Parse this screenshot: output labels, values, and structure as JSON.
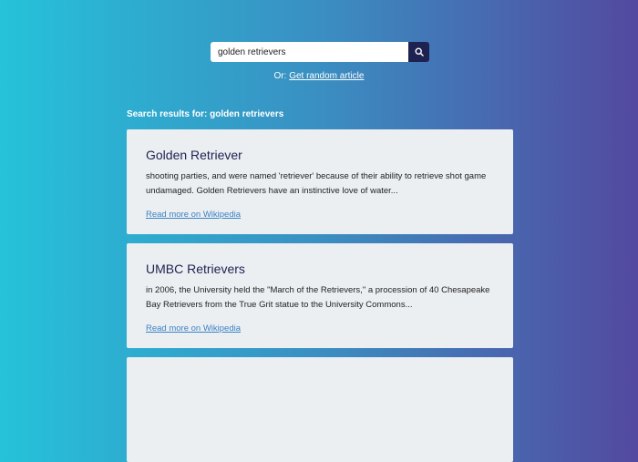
{
  "search": {
    "value": "golden retrievers"
  },
  "random": {
    "prefix": "Or: ",
    "link": "Get random article"
  },
  "results": {
    "heading": "Search results for: golden retrievers",
    "items": [
      {
        "title": "Golden Retriever",
        "snippet": "shooting parties, and were named 'retriever' because of their ability to retrieve shot game undamaged. Golden Retrievers have an instinctive love of water...",
        "link": "Read more on Wikipedia"
      },
      {
        "title": "UMBC Retrievers",
        "snippet": "in 2006, the University held the \"March of the Retrievers,\" a procession of 40 Chesapeake Bay Retrievers from the True Grit statue to the University Commons...",
        "link": "Read more on Wikipedia"
      }
    ]
  }
}
